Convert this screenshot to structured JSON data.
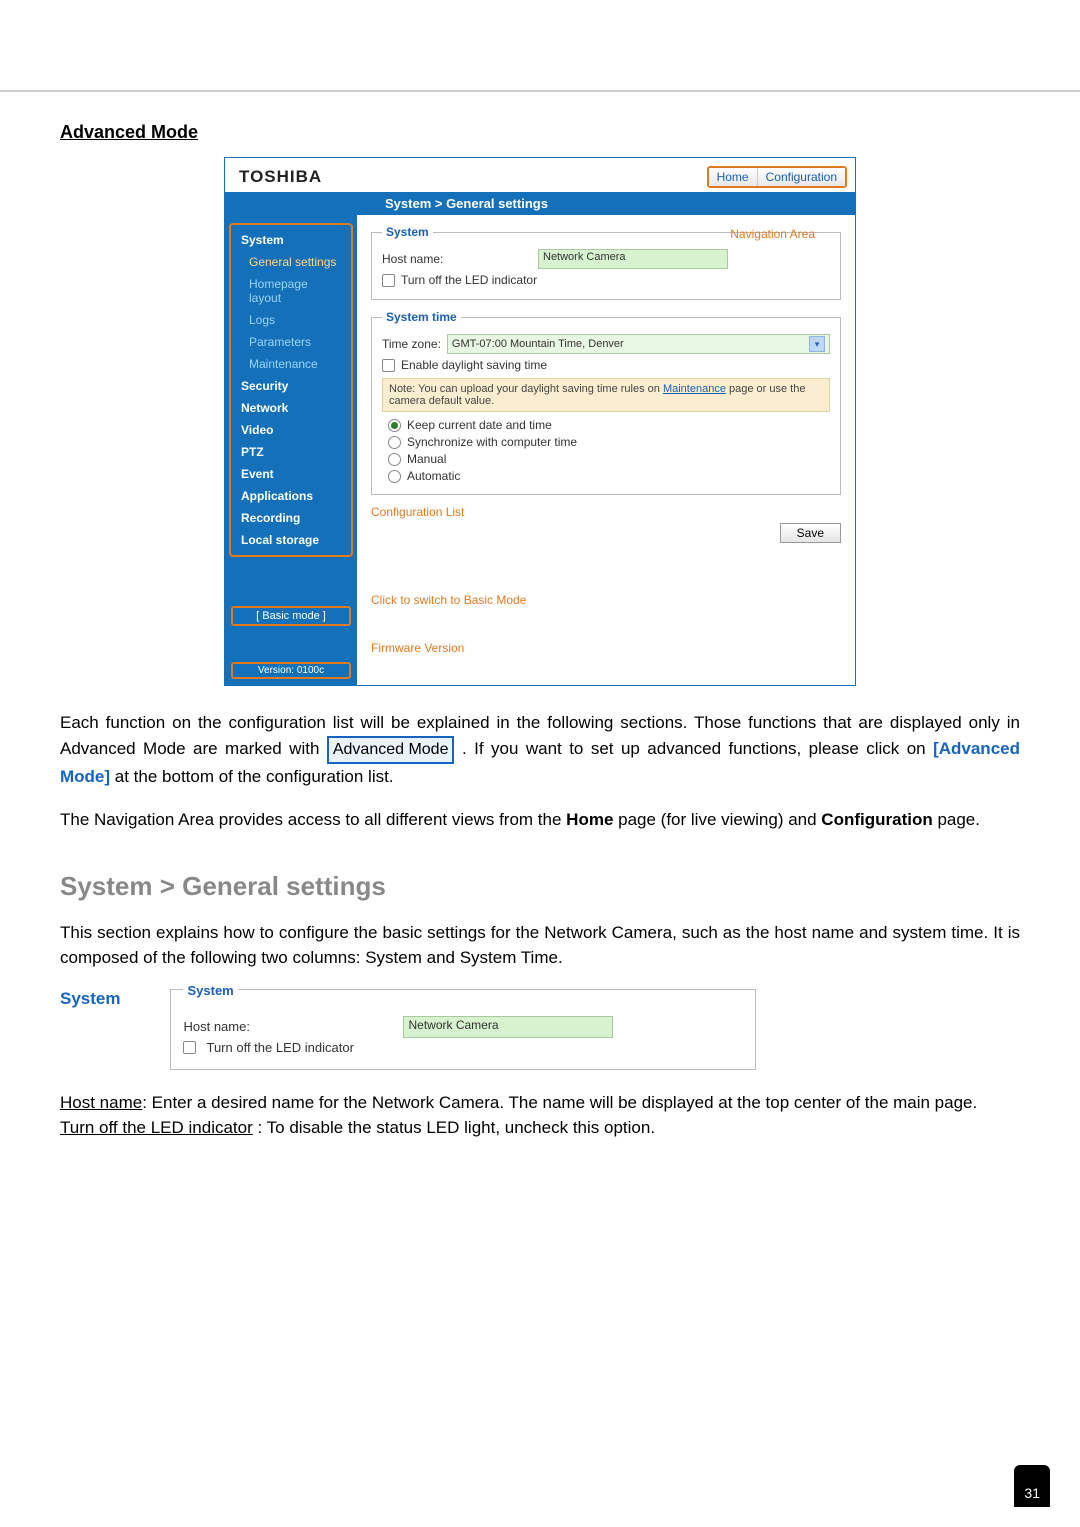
{
  "title": "Advanced Mode",
  "brand": "TOSHIBA",
  "navTabs": {
    "home": "Home",
    "config": "Configuration"
  },
  "breadcrumb": "System > General settings",
  "navAreaLabel": "Navigation Area",
  "sidebar": {
    "system": "System",
    "sub": {
      "general": "General settings",
      "homepage": "Homepage layout",
      "logs": "Logs",
      "parameters": "Parameters",
      "maintenance": "Maintenance"
    },
    "security": "Security",
    "network": "Network",
    "video": "Video",
    "ptz": "PTZ",
    "event": "Event",
    "applications": "Applications",
    "recording": "Recording",
    "local": "Local storage",
    "basicMode": "[ Basic mode ]",
    "version": "Version: 0100c"
  },
  "panel": {
    "systemLegend": "System",
    "hostnameLabel": "Host name:",
    "hostnameValue": "Network Camera",
    "ledLabel": "Turn off the LED indicator",
    "timeLegend": "System time",
    "tzLabel": "Time zone:",
    "tzValue": "GMT-07:00 Mountain Time, Denver",
    "dstLabel": "Enable daylight saving time",
    "notePrefix": "Note: You can upload your daylight saving time rules on ",
    "noteLink": "Maintenance",
    "noteSuffix": " page or use the camera default value.",
    "radioKeep": "Keep current date and time",
    "radioSync": "Synchronize with computer time",
    "radioManual": "Manual",
    "radioAuto": "Automatic",
    "save": "Save"
  },
  "callouts": {
    "configList": "Configuration List",
    "basicMode": "Click to switch to Basic Mode",
    "firmware": "Firmware Version"
  },
  "body": {
    "p1a": "Each function on the configuration list will be explained in the following sections. Those functions that are displayed only in Advanced Mode are marked with ",
    "p1badge": "Advanced Mode",
    "p1b": ". If you want to set up advanced functions, please click on ",
    "p1link": "[Advanced Mode]",
    "p1c": " at the bottom of the configuration list.",
    "p2a": "The Navigation Area provides access to all different views from the ",
    "p2home": "Home",
    "p2b": " page (for live viewing) and ",
    "p2conf": "Configuration",
    "p2c": " page.",
    "sectionHead": "System > General settings",
    "p3": "This section explains how to configure the basic settings for the Network Camera, such as the host name and system time. It is composed of the following two columns: System and System Time.",
    "systemSub": "System",
    "sysLegend": "System",
    "sysHostLabel": "Host name:",
    "sysHostValue": "Network Camera",
    "sysLed": "Turn off the LED indicator",
    "defHostTerm": "Host name",
    "defHostText": ": Enter a desired name for the Network Camera. The name will be displayed at the top center of the main page.",
    "defLedTerm": "Turn off the LED indicator",
    "defLedText": " : To disable the status LED light, uncheck this option."
  },
  "pageNumber": "31"
}
